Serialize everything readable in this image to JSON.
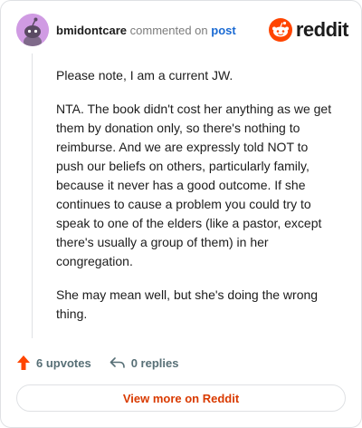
{
  "header": {
    "username": "bmidontcare",
    "action_text": "commented on",
    "post_link": "post",
    "logo_text": "reddit"
  },
  "comment": {
    "paragraphs": [
      "Please note, I am a current JW.",
      "NTA. The book didn't cost her anything as we get them by donation only, so there's nothing to reimburse. And we are expressly told NOT to push our beliefs on others, particularly family, because it never has a good outcome. If she continues to cause a problem you could try to speak to one of the elders (like a pastor, except there's usually a group of them) in her congregation.",
      "She may mean well, but she's doing the wrong thing."
    ]
  },
  "actions": {
    "upvotes": "6 upvotes",
    "replies": "0 replies"
  },
  "footer": {
    "view_more": "View more on Reddit"
  },
  "colors": {
    "brand": "#ff4500",
    "link": "#1a6ad3",
    "view_more": "#d93a00",
    "avatar_bg": "#d09be3"
  },
  "icons": [
    "reddit-snoo-avatar-icon",
    "reddit-logo-icon",
    "upvote-arrow-icon",
    "reply-arrow-icon"
  ]
}
